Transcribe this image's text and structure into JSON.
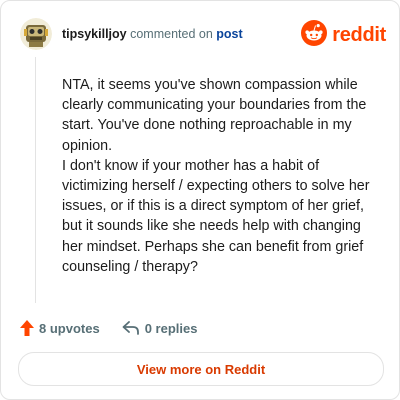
{
  "comment": {
    "username": "tipsykilljoy",
    "action_text": "commented on",
    "post_link": "post",
    "paragraphs": [
      "NTA, it seems you've shown compassion while clearly communicating your boundaries from the start. You've done nothing reproachable in my opinion.",
      "I don't know if your mother has a habit of victimizing herself / expecting others to solve her issues, or if this is a direct symptom of her grief, but it sounds like she needs help with changing her mindset. Perhaps she can benefit from grief counseling / therapy?"
    ]
  },
  "brand": {
    "name": "reddit",
    "color": "#ff4500",
    "icon": "reddit-snoo-icon"
  },
  "footer": {
    "upvotes": "8 upvotes",
    "replies": "0 replies",
    "upvote_icon": "upvote-arrow-icon",
    "reply_icon": "reply-arrow-icon"
  },
  "cta": {
    "label": "View more on Reddit"
  },
  "colors": {
    "upvote": "#ff4500",
    "link": "#0a449b",
    "cta_text": "#d93a00",
    "muted": "#576f76"
  }
}
